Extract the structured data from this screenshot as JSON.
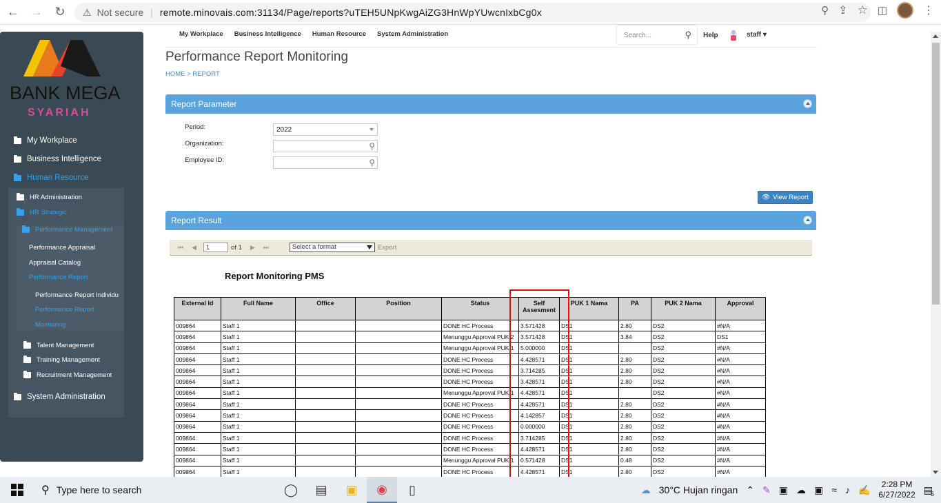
{
  "browser": {
    "not_secure": "Not secure",
    "url": "remote.minovais.com:31134/Page/reports?uTEH5UNpKwgAiZG3HnWpYUwcnIxbCg0x"
  },
  "logo": {
    "line1": "BANK MEGA",
    "line2": "SYARIAH"
  },
  "sidebar": {
    "my_workplace": "My Workplace",
    "business_intelligence": "Business Intelligence",
    "human_resource": "Human Resource",
    "hr_administration": "HR Administration",
    "hr_strategic": "HR Strategic",
    "performance_management": "Performance Management",
    "performance_appraisal": "Performance Appraisal",
    "appraisal_catalog": "Appraisal Catalog",
    "performance_report": "Performance Report",
    "performance_report_individu": "Performance Report Individu",
    "performance_report_sub": "Performance Report",
    "monitoring": "Monitoring",
    "talent_management": "Talent Management",
    "training_management": "Training Management",
    "recruitment_management": "Recruitment Management",
    "system_administration": "System Administration"
  },
  "topnav": {
    "items": [
      "My Workplace",
      "Business Intelligence",
      "Human Resource",
      "System Administration"
    ],
    "search_placeholder": "Search...",
    "help": "Help",
    "user": "staff"
  },
  "page": {
    "title": "Performance Report Monitoring",
    "breadcrumb": "HOME > REPORT"
  },
  "parameter": {
    "header": "Report Parameter",
    "period_label": "Period:",
    "period_value": "2022",
    "organization_label": "Organization:",
    "employee_label": "Employee ID:",
    "view_button": "View Report"
  },
  "result": {
    "header": "Report Result",
    "page_value": "1",
    "page_of": "of 1",
    "format_placeholder": "Select a format",
    "export": "Export",
    "report_title": "Report Monitoring PMS",
    "columns": [
      "External Id",
      "Full Name",
      "Office",
      "Position",
      "Status",
      "Self Assesment",
      "PUK 1 Nama",
      "PA",
      "PUK 2 Nama",
      "Approval"
    ],
    "rows": [
      [
        "009864",
        "Staff 1",
        "",
        "",
        "DONE HC Process",
        "3.571428",
        "DS1",
        "2.80",
        "DS2",
        "#N/A"
      ],
      [
        "009864",
        "Staff 1",
        "",
        "",
        "Menunggu Approval PUK 2",
        "3.571428",
        "DS1",
        "3.84",
        "DS2",
        "DS1"
      ],
      [
        "009864",
        "Staff 1",
        "",
        "",
        "Menunggu Approval PUK 1",
        "5.000000",
        "DS1",
        "",
        "DS2",
        "#N/A"
      ],
      [
        "009864",
        "Staff 1",
        "",
        "",
        "DONE HC Process",
        "4.428571",
        "DS1",
        "2.80",
        "DS2",
        "#N/A"
      ],
      [
        "009864",
        "Staff 1",
        "",
        "",
        "DONE HC Process",
        "3.714285",
        "DS1",
        "2.80",
        "DS2",
        "#N/A"
      ],
      [
        "009864",
        "Staff 1",
        "",
        "",
        "DONE HC Process",
        "3.428571",
        "DS1",
        "2.80",
        "DS2",
        "#N/A"
      ],
      [
        "009864",
        "Staff 1",
        "",
        "",
        "Menunggu Approval PUK 1",
        "4.428571",
        "DS1",
        "",
        "DS2",
        "#N/A"
      ],
      [
        "009864",
        "Staff 1",
        "",
        "",
        "DONE HC Process",
        "4.428571",
        "DS1",
        "2.80",
        "DS2",
        "#N/A"
      ],
      [
        "009864",
        "Staff 1",
        "",
        "",
        "DONE HC Process",
        "4.142857",
        "DS1",
        "2.80",
        "DS2",
        "#N/A"
      ],
      [
        "009864",
        "Staff 1",
        "",
        "",
        "DONE HC Process",
        "0.000000",
        "DS1",
        "2.80",
        "DS2",
        "#N/A"
      ],
      [
        "009864",
        "Staff 1",
        "",
        "",
        "DONE HC Process",
        "3.714285",
        "DS1",
        "2.80",
        "DS2",
        "#N/A"
      ],
      [
        "009864",
        "Staff 1",
        "",
        "",
        "DONE HC Process",
        "4.428571",
        "DS1",
        "2.80",
        "DS2",
        "#N/A"
      ],
      [
        "009864",
        "Staff 1",
        "",
        "",
        "Menunggu Approval PUK 1",
        "0.571428",
        "DS1",
        "0.48",
        "DS2",
        "#N/A"
      ],
      [
        "009864",
        "Staff 1",
        "",
        "",
        "DONE HC Process",
        "4.428571",
        "DS1",
        "2.80",
        "DS2",
        "#N/A"
      ]
    ]
  },
  "taskbar": {
    "search_placeholder": "Type here to search",
    "weather": "30°C  Hujan ringan",
    "time": "2:28 PM",
    "date": "6/27/2022",
    "notifications": "5"
  }
}
